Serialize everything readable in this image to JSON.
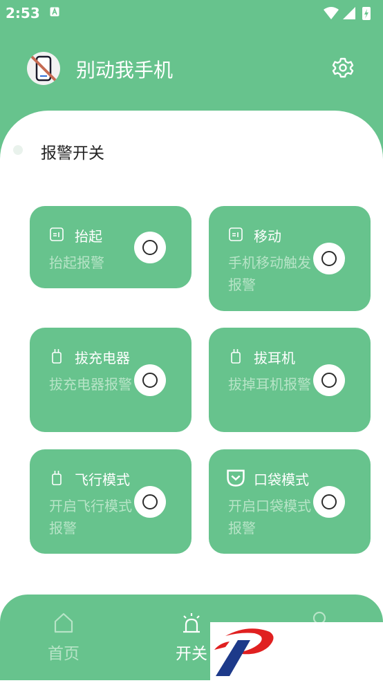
{
  "status_bar": {
    "time": "2:53"
  },
  "header": {
    "title": "别动我手机"
  },
  "section": {
    "title": "报警开关"
  },
  "cards": [
    {
      "title": "抬起",
      "description": "抬起报警",
      "icon": "note-icon",
      "enabled": false
    },
    {
      "title": "移动",
      "description": "手机移动触发报警",
      "icon": "note-icon",
      "enabled": false
    },
    {
      "title": "拔充电器",
      "description": "拔充电器报警",
      "icon": "plug-icon",
      "enabled": false
    },
    {
      "title": "拔耳机",
      "description": "拔掉耳机报警",
      "icon": "plug-icon",
      "enabled": false
    },
    {
      "title": "飞行模式",
      "description": "开启飞行模式报警",
      "icon": "plug-icon",
      "enabled": false
    },
    {
      "title": "口袋模式",
      "description": "开启口袋模式报警",
      "icon": "pocket-icon",
      "enabled": false
    }
  ],
  "bottom_nav": {
    "items": [
      {
        "label": "首页",
        "icon": "home-icon",
        "active": false
      },
      {
        "label": "开关",
        "icon": "alarm-light-icon",
        "active": true
      },
      {
        "label": "",
        "icon": "profile-icon",
        "active": false
      }
    ]
  },
  "colors": {
    "primary": "#67c38d",
    "inactive_text": "#b7e4c7",
    "background": "#ffffff"
  }
}
